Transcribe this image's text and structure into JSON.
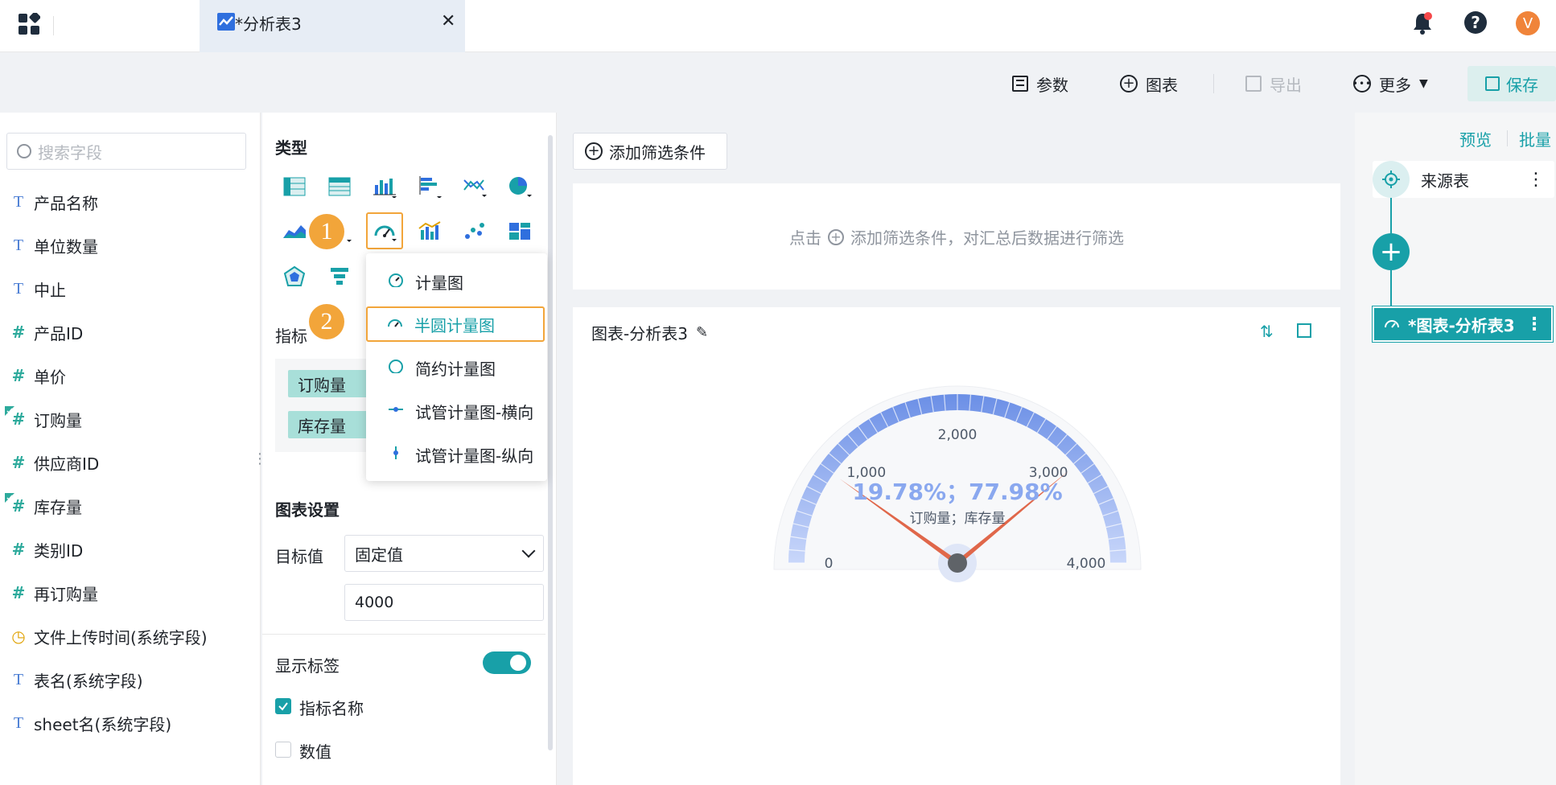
{
  "tab": {
    "title": "*分析表3"
  },
  "header": {
    "avatar_letter": "V"
  },
  "toolbar": {
    "params": "参数",
    "chart": "图表",
    "export": "导出",
    "more": "更多",
    "save": "保存"
  },
  "fields": {
    "search_placeholder": "搜索字段",
    "items": [
      {
        "type": "T",
        "label": "产品名称"
      },
      {
        "type": "T",
        "label": "单位数量"
      },
      {
        "type": "T",
        "label": "中止"
      },
      {
        "type": "#",
        "label": "产品ID"
      },
      {
        "type": "#",
        "label": "单价"
      },
      {
        "type": "#",
        "label": "订购量",
        "used": true
      },
      {
        "type": "#",
        "label": "供应商ID"
      },
      {
        "type": "#",
        "label": "库存量",
        "used": true
      },
      {
        "type": "#",
        "label": "类别ID"
      },
      {
        "type": "#",
        "label": "再订购量"
      },
      {
        "type": "clock",
        "label": "文件上传时间(系统字段)"
      },
      {
        "type": "T",
        "label": "表名(系统字段)"
      },
      {
        "type": "T",
        "label": "sheet名(系统字段)"
      }
    ]
  },
  "config": {
    "type_title": "类型",
    "metric_title": "指标",
    "metrics": [
      "订购量",
      "库存量"
    ],
    "settings_title": "图表设置",
    "target_label": "目标值",
    "target_mode": "固定值",
    "target_value": "4000",
    "show_label": "显示标签",
    "show_label_on": true,
    "metric_name": "指标名称",
    "metric_name_checked": true,
    "value": "数值",
    "value_checked": false,
    "badge1": "1",
    "badge2": "2"
  },
  "dropdown": {
    "items": [
      "计量图",
      "半圆计量图",
      "简约计量图",
      "试管计量图-横向",
      "试管计量图-纵向"
    ],
    "active_index": 1
  },
  "filter": {
    "add_label": "添加筛选条件",
    "hint_prefix": "点击",
    "hint_text": "添加筛选条件，对汇总后数据进行筛选"
  },
  "chart_title": "图表-分析表3",
  "right": {
    "preview": "预览",
    "batch": "批量",
    "source": "来源表",
    "chart_node": "*图表-分析表3"
  },
  "chart_data": {
    "type": "gauge",
    "min": 0,
    "max": 4000,
    "ticks": [
      "0",
      "1,000",
      "2,000",
      "3,000",
      "4,000"
    ],
    "values": [
      {
        "name": "订购量",
        "value": 791.2,
        "percent": "19.78%"
      },
      {
        "name": "库存量",
        "value": 3119.2,
        "percent": "77.98%"
      }
    ],
    "center_value_text": "19.78%；77.98%",
    "center_label_text": "订购量；库存量",
    "colors": {
      "arc": "#6b8fe6",
      "needle": "#e0674a",
      "value_text": "#8aa8ef"
    }
  }
}
